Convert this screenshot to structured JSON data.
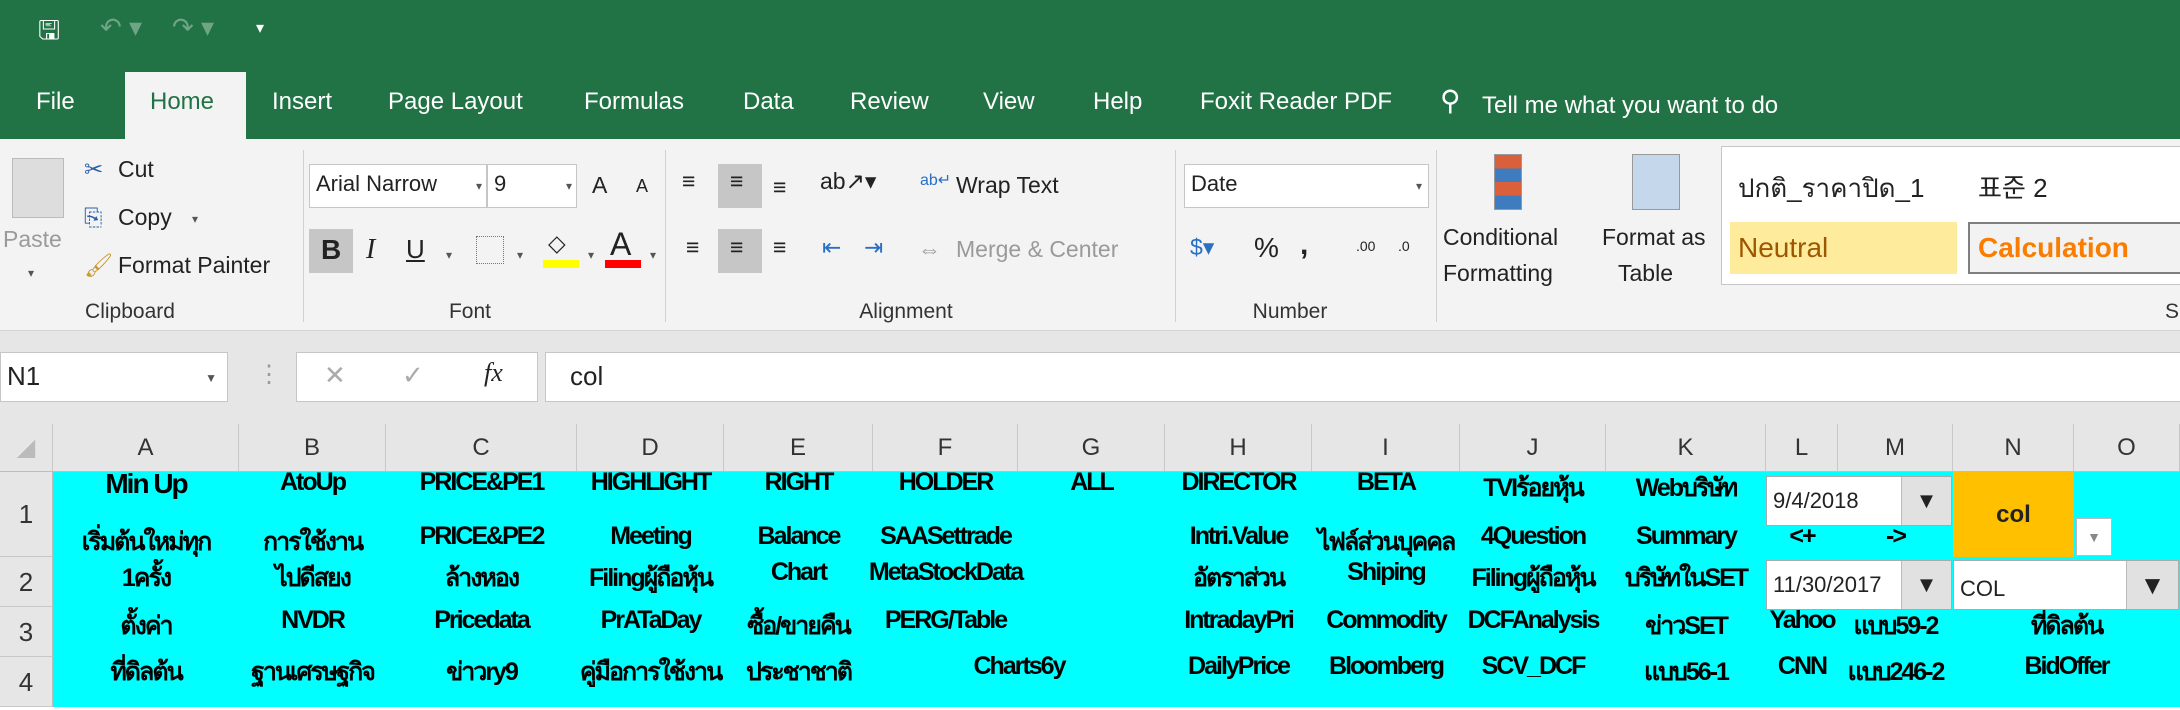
{
  "quick_access": {
    "save": "save-icon",
    "undo": "undo-icon",
    "redo": "redo-icon",
    "customize": "customize-icon"
  },
  "tabs": [
    "File",
    "Home",
    "Insert",
    "Page Layout",
    "Formulas",
    "Data",
    "Review",
    "View",
    "Help",
    "Foxit Reader PDF"
  ],
  "tell_me": "Tell me what you want to do",
  "clipboard": {
    "paste": "Paste",
    "cut": "Cut",
    "copy": "Copy",
    "format_painter": "Format Painter",
    "label": "Clipboard"
  },
  "font": {
    "name": "Arial Narrow",
    "size": "9",
    "bold": "B",
    "italic": "I",
    "underline": "U",
    "grow": "A",
    "shrink": "A",
    "font_color": "A",
    "label": "Font",
    "fill_color": "#FFFF00",
    "text_color": "#FF0000"
  },
  "alignment": {
    "wrap_text": "Wrap Text",
    "merge_center": "Merge & Center",
    "label": "Alignment"
  },
  "number": {
    "format": "Date",
    "percent": "%",
    "comma": ",",
    "inc_decimal": ".00",
    "dec_decimal": ".0",
    "label": "Number"
  },
  "styles": {
    "conditional": [
      "Conditional",
      "Formatting"
    ],
    "format_table": [
      "Format as",
      "Table"
    ],
    "style1": "ปกติ_ราคาปิด_1",
    "style2": "표준 2",
    "neutral": "Neutral",
    "calculation": "Calculation",
    "label": "S"
  },
  "formula_bar": {
    "name_box": "N1",
    "cancel": "✕",
    "enter": "✓",
    "fx": "fx",
    "content": "col"
  },
  "columns": [
    "A",
    "B",
    "C",
    "D",
    "E",
    "F",
    "G",
    "H",
    "I",
    "J",
    "K",
    "L",
    "M",
    "N",
    "O"
  ],
  "rows": [
    "1",
    "2",
    "3",
    "4"
  ],
  "lines": [
    [
      [
        "A",
        "Min Up"
      ],
      [
        "B",
        "AtoUp"
      ],
      [
        "C",
        "PRICE&PE1"
      ],
      [
        "D",
        "HIGHLIGHT"
      ],
      [
        "E",
        "RIGHT"
      ],
      [
        "F",
        "HOLDER"
      ],
      [
        "G",
        "ALL"
      ],
      [
        "H",
        "DIRECTOR"
      ],
      [
        "I",
        "BETA"
      ],
      [
        "J",
        "TVIร้อยหุ้น"
      ],
      [
        "K",
        "Webบริษัท"
      ]
    ],
    [
      [
        "A",
        "เริ่มต้นใหม่ทุก"
      ],
      [
        "B",
        "การใช้งาน"
      ],
      [
        "C",
        "PRICE&PE2"
      ],
      [
        "D",
        "Meeting"
      ],
      [
        "E",
        "Balance"
      ],
      [
        "F",
        "SAASettrade"
      ],
      [
        "H",
        "Intri.Value"
      ],
      [
        "I",
        "ไฟล์ส่วนบุคคล"
      ],
      [
        "J",
        "4Question"
      ],
      [
        "K",
        "Summary"
      ],
      [
        "L",
        "<+"
      ],
      [
        "M",
        "->"
      ]
    ],
    [
      [
        "A",
        "1ครั้ง"
      ],
      [
        "B",
        "ไปดีสยง"
      ],
      [
        "C",
        "ล้างหอง"
      ],
      [
        "D",
        "Filingผู้ถือหุ้น"
      ],
      [
        "E",
        "Chart"
      ],
      [
        "F",
        "MetaStockData"
      ],
      [
        "H",
        "อัตราส่วน"
      ],
      [
        "I",
        "Shiping"
      ],
      [
        "J",
        "Filingผู้ถือหุ้น"
      ],
      [
        "K",
        "บริษัทในSET"
      ]
    ],
    [
      [
        "A",
        "ตั้งค่า"
      ],
      [
        "B",
        "NVDR"
      ],
      [
        "C",
        "Pricedata"
      ],
      [
        "D",
        "PrATaDay"
      ],
      [
        "E",
        "ซื้อ/ขายคืน"
      ],
      [
        "F",
        "PERG/Table"
      ],
      [
        "H",
        "IntradayPri"
      ],
      [
        "I",
        "Commodity"
      ],
      [
        "J",
        "DCFAnalysis"
      ],
      [
        "K",
        "ข่าวSET"
      ],
      [
        "L",
        "Yahoo"
      ],
      [
        "M",
        "แบบ59-2"
      ],
      [
        "NO",
        "ที่ดิลต้น"
      ]
    ],
    [
      [
        "A",
        "ที่ดิลต้น"
      ],
      [
        "B",
        "ฐานเศรษฐกิจ"
      ],
      [
        "C",
        "ข่าวry9"
      ],
      [
        "D",
        "คู่มือการใช้งาน"
      ],
      [
        "E",
        "ประชาชาติ"
      ],
      [
        "FG",
        "Charts6y"
      ],
      [
        "H",
        "DailyPrice"
      ],
      [
        "I",
        "Bloomberg"
      ],
      [
        "J",
        "SCV_DCF"
      ],
      [
        "K",
        "แบบ56-1"
      ],
      [
        "L",
        "CNN"
      ],
      [
        "M",
        "แบบ246-2"
      ],
      [
        "NO",
        "BidOffer"
      ]
    ]
  ],
  "controls": {
    "date1": "9/4/2018",
    "date2": "11/30/2017",
    "n1_value": "col",
    "col_select": "COL",
    "n1_color": "#FFC000",
    "cyan": "#00FFFF"
  }
}
